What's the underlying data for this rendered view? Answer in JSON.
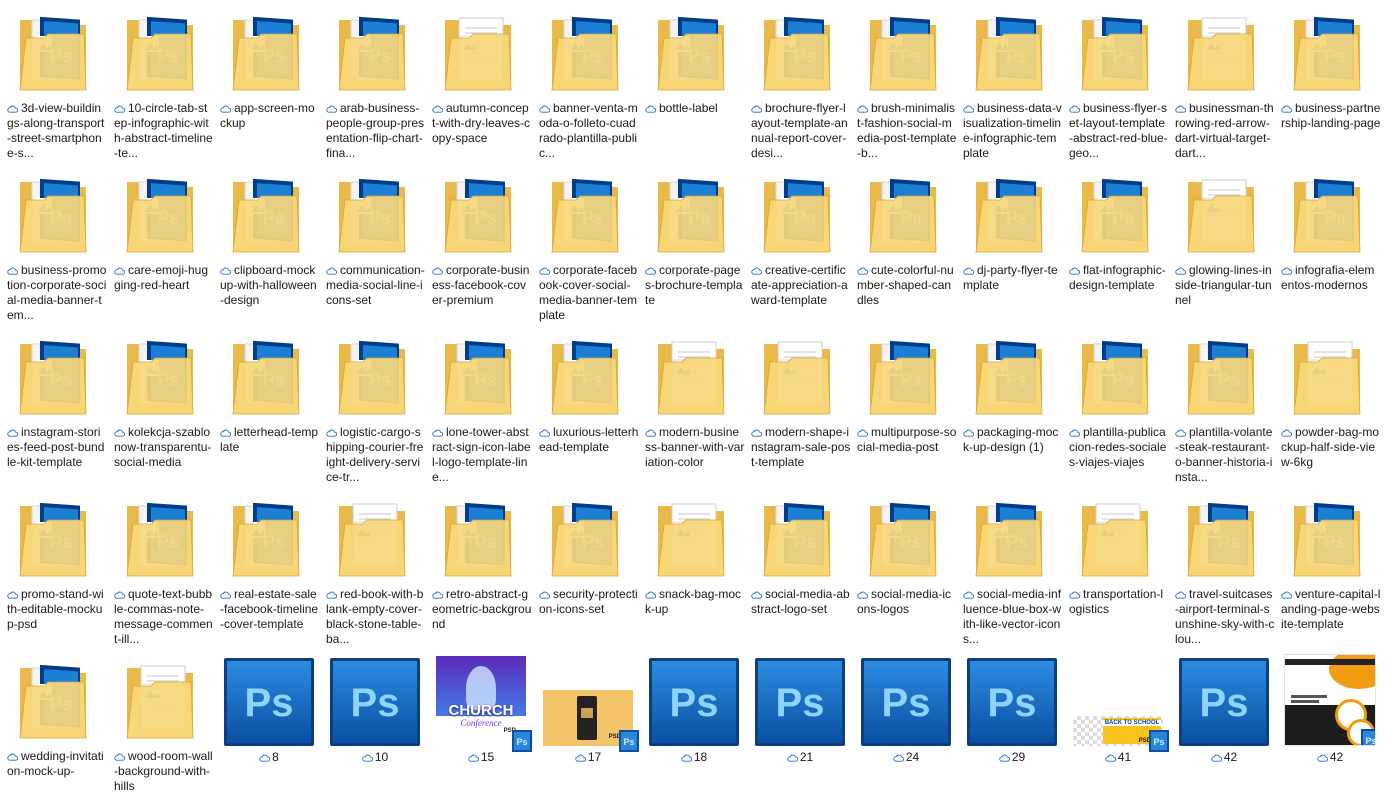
{
  "window": {
    "title": ""
  },
  "folders": [
    {
      "name": "3d-view-buildings-along-transport-street-smartphone-s...",
      "variant": "ps"
    },
    {
      "name": "10-circle-tab-step-infographic-with-abstract-timeline-te...",
      "variant": "ps"
    },
    {
      "name": "app-screen-mockup",
      "variant": "ps"
    },
    {
      "name": "arab-business-people-group-presentation-flip-chart-fina...",
      "variant": "ps"
    },
    {
      "name": "autumn-concept-with-dry-leaves-copy-space",
      "variant": "doc"
    },
    {
      "name": "banner-venta-moda-o-folleto-cuadrado-plantilla-public...",
      "variant": "ps"
    },
    {
      "name": "bottle-label",
      "variant": "ps"
    },
    {
      "name": "brochure-flyer-layout-template-annual-report-cover-desi...",
      "variant": "ps"
    },
    {
      "name": "brush-minimalist-fashion-social-media-post-template-b...",
      "variant": "ps"
    },
    {
      "name": "business-data-visualization-timeline-infographic-template",
      "variant": "ps"
    },
    {
      "name": "business-flyer-set-layout-template-abstract-red-blue-geo...",
      "variant": "ps"
    },
    {
      "name": "businessman-throwing-red-arrow-dart-virtual-target-dart...",
      "variant": "doc"
    },
    {
      "name": "business-partnership-landing-page",
      "variant": "ps"
    },
    {
      "name": "business-promotion-corporate-social-media-banner-tem...",
      "variant": "ps"
    },
    {
      "name": "care-emoji-hugging-red-heart",
      "variant": "ps"
    },
    {
      "name": "clipboard-mockup-with-halloween-design",
      "variant": "ps"
    },
    {
      "name": "communication-media-social-line-icons-set",
      "variant": "ps"
    },
    {
      "name": "corporate-business-facebook-cover-premium",
      "variant": "ps"
    },
    {
      "name": "corporate-facebook-cover-social-media-banner-template",
      "variant": "ps"
    },
    {
      "name": "corporate-pages-brochure-template",
      "variant": "ps"
    },
    {
      "name": "creative-certificate-appreciation-award-template",
      "variant": "ps"
    },
    {
      "name": "cute-colorful-number-shaped-candles",
      "variant": "ps"
    },
    {
      "name": "dj-party-flyer-template",
      "variant": "ps"
    },
    {
      "name": "flat-infographic-design-template",
      "variant": "ps"
    },
    {
      "name": "glowing-lines-inside-triangular-tunnel",
      "variant": "doc"
    },
    {
      "name": "infografia-elementos-modernos",
      "variant": "ps"
    },
    {
      "name": "instagram-stories-feed-post-bundle-kit-template",
      "variant": "ps"
    },
    {
      "name": "kolekcja-szablonow-transparentu-social-media",
      "variant": "ps"
    },
    {
      "name": "letterhead-template",
      "variant": "ps"
    },
    {
      "name": "logistic-cargo-shipping-courier-freight-delivery-service-tr...",
      "variant": "ps"
    },
    {
      "name": "lone-tower-abstract-sign-icon-label-logo-template-line...",
      "variant": "ps"
    },
    {
      "name": "luxurious-letterhead-template",
      "variant": "ps"
    },
    {
      "name": "modern-business-banner-with-variation-color",
      "variant": "doc"
    },
    {
      "name": "modern-shape-instagram-sale-post-template",
      "variant": "doc"
    },
    {
      "name": "multipurpose-social-media-post",
      "variant": "ps"
    },
    {
      "name": "packaging-mock-up-design (1)",
      "variant": "ps"
    },
    {
      "name": "plantilla-publicacion-redes-sociales-viajes-viajes",
      "variant": "ps"
    },
    {
      "name": "plantilla-volante-steak-restaurant-o-banner-historia-insta...",
      "variant": "ps"
    },
    {
      "name": "powder-bag-mockup-half-side-view-6kg",
      "variant": "doc"
    },
    {
      "name": "promo-stand-with-editable-mockup-psd",
      "variant": "ps"
    },
    {
      "name": "quote-text-bubble-commas-note-message-comment-ill...",
      "variant": "ps"
    },
    {
      "name": "real-estate-sale-facebook-timeline-cover-template",
      "variant": "ps"
    },
    {
      "name": "red-book-with-blank-empty-cover-black-stone-table-ba...",
      "variant": "doc"
    },
    {
      "name": "retro-abstract-geometric-background",
      "variant": "ps"
    },
    {
      "name": "security-protection-icons-set",
      "variant": "ps"
    },
    {
      "name": "snack-bag-mock-up",
      "variant": "doc"
    },
    {
      "name": "social-media-abstract-logo-set",
      "variant": "ps"
    },
    {
      "name": "social-media-icons-logos",
      "variant": "ps"
    },
    {
      "name": "social-media-influence-blue-box-with-like-vector-icons...",
      "variant": "ps"
    },
    {
      "name": "transportation-logistics",
      "variant": "doc"
    },
    {
      "name": "travel-suitcases-airport-terminal-sunshine-sky-with-clou...",
      "variant": "ps"
    },
    {
      "name": "venture-capital-landing-page-website-template",
      "variant": "ps"
    },
    {
      "name": "wedding-invitation-mock-up-",
      "variant": "ps"
    },
    {
      "name": "wood-room-wall-background-with-hills",
      "variant": "doc"
    }
  ],
  "files": [
    {
      "name": "8",
      "type": "ps"
    },
    {
      "name": "10",
      "type": "ps"
    },
    {
      "name": "15",
      "type": "church-thumb",
      "thumb_text_1": "CHURCH",
      "thumb_text_2": "Conference",
      "badge": "PSD"
    },
    {
      "name": "17",
      "type": "bag-thumb",
      "badge": "PSD"
    },
    {
      "name": "18",
      "type": "ps"
    },
    {
      "name": "21",
      "type": "ps"
    },
    {
      "name": "24",
      "type": "ps"
    },
    {
      "name": "29",
      "type": "ps"
    },
    {
      "name": "41",
      "type": "banner-thumb",
      "thumb_text_1": "BACK TO SCHOOL",
      "badge": "PSD"
    },
    {
      "name": "42",
      "type": "ps"
    },
    {
      "name": "42",
      "type": "flyer-thumb",
      "badge": "PSD"
    }
  ],
  "icons": {
    "ps_text": "Ps",
    "cloud": "cloud-icon"
  },
  "colors": {
    "folder_back": "#e9b949",
    "folder_front": "#f8d77a",
    "ps_blue_dark": "#003c88",
    "ps_blue": "#1b7fd6",
    "ps_text": "#8fd3ff",
    "cloud": "#1f6fd0"
  }
}
